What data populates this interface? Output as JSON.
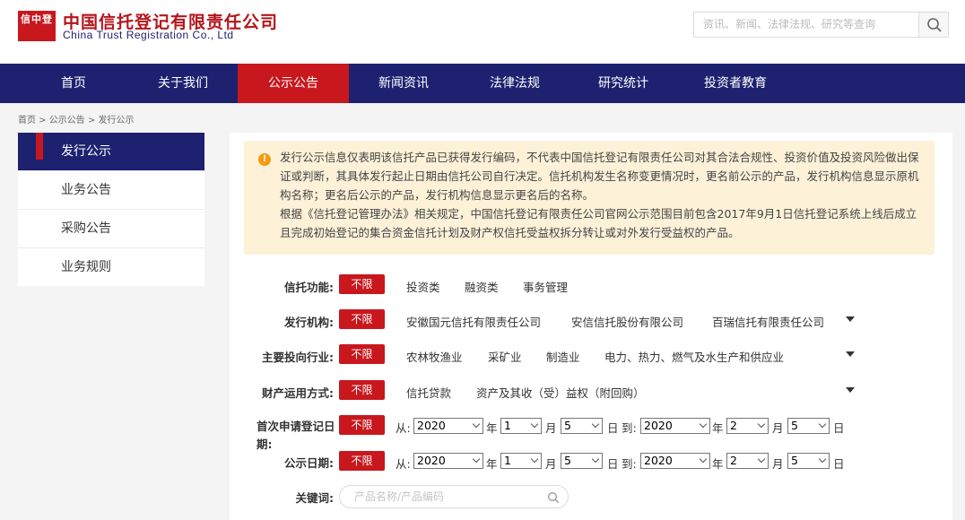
{
  "header": {
    "logo_mark": "信中登",
    "logo_cn": "中国信托登记有限责任公司",
    "logo_en": "China Trust Registration Co., Ltd",
    "search_placeholder": "资讯、新闻、法律法规、研究等查询"
  },
  "nav": [
    "首页",
    "关于我们",
    "公示公告",
    "新闻资讯",
    "法律法规",
    "研究统计",
    "投资者教育"
  ],
  "nav_active": "公示公告",
  "breadcrumb": [
    "首页",
    "公示公告",
    "发行公示"
  ],
  "sidebar": [
    "发行公示",
    "业务公告",
    "采购公告",
    "业务规则"
  ],
  "notice": {
    "p1": "发行公示信息仅表明该信托产品已获得发行编码，不代表中国信托登记有限责任公司对其合法合规性、投资价值及投资风险做出保证或判断，其具体发行起止日期由信托公司自行决定。信托机构发生名称变更情况时，更名前公示的产品，发行机构信息显示原机构名称；更名后公示的产品，发行机构信息显示更名后的名称。",
    "p2": "根据《信托登记管理办法》相关规定，中国信托登记有限责任公司官网公示范围目前包含2017年9月1日信托登记系统上线后成立且完成初始登记的集合资金信托计划及财产权信托受益权拆分转让或对外发行受益权的产品。"
  },
  "filters": {
    "all_label": "不限",
    "function": {
      "label": "信托功能:",
      "options": [
        "投资类",
        "融资类",
        "事务管理"
      ]
    },
    "issuer": {
      "label": "发行机构:",
      "options": [
        "安徽国元信托有限责任公司",
        "安信信托股份有限公司",
        "百瑞信托有限责任公司"
      ]
    },
    "industry": {
      "label": "主要投向行业:",
      "options": [
        "农林牧渔业",
        "采矿业",
        "制造业",
        "电力、热力、燃气及水生产和供应业"
      ]
    },
    "usage": {
      "label": "财产运用方式:",
      "options": [
        "信托贷款",
        "资产及其收（受）益权（附回购）"
      ]
    },
    "first_reg": {
      "label": "首次申请登记日期:",
      "from": "从:",
      "to": "到:",
      "year_unit": "年",
      "month_unit": "月",
      "day_unit": "日",
      "from_year": "2020",
      "from_month": "1",
      "from_day": "5",
      "to_year": "2020",
      "to_month": "2",
      "to_day": "5"
    },
    "pub_date": {
      "label": "公示日期:",
      "from": "从:",
      "to": "到:",
      "year_unit": "年",
      "month_unit": "月",
      "day_unit": "日",
      "from_year": "2020",
      "from_month": "1",
      "from_day": "5",
      "to_year": "2020",
      "to_month": "2",
      "to_day": "5"
    },
    "keyword": {
      "label": "关键词:",
      "placeholder": "产品名称/产品编码"
    }
  },
  "colors": {
    "brand_red": "#c8171d",
    "nav_blue": "#1d2170",
    "notice_bg": "#fdf1d8"
  }
}
